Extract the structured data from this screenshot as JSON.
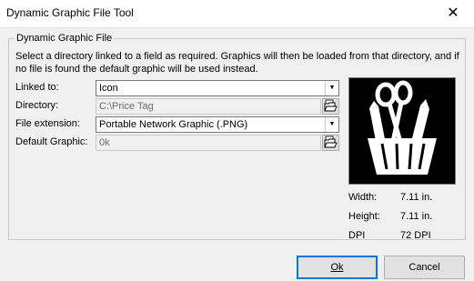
{
  "window": {
    "title": "Dynamic Graphic File Tool",
    "close_glyph": "✕"
  },
  "group": {
    "legend": "Dynamic Graphic File",
    "description": "Select a directory linked to a field as required. Graphics will then be loaded from that directory, and if no file is found the default graphic will be used instead."
  },
  "fields": {
    "linked_to": {
      "label": "Linked to:",
      "value": "Icon"
    },
    "directory": {
      "label": "Directory:",
      "value": "C:\\Price Tag"
    },
    "file_extension": {
      "label": "File extension:",
      "value": "Portable Network Graphic (.PNG)"
    },
    "default_graphic": {
      "label": "Default Graphic:",
      "value": "0k"
    }
  },
  "preview": {
    "icon": "scissors-pencil-cup-icon",
    "width_label": "Width:",
    "width_value": "7.11 in.",
    "height_label": "Height:",
    "height_value": "7.11 in.",
    "dpi_label": "DPI",
    "dpi_value": "72 DPI"
  },
  "buttons": {
    "ok": "Ok",
    "cancel": "Cancel"
  },
  "colors": {
    "accent": "#0078d7",
    "preview_bg": "#000000"
  }
}
